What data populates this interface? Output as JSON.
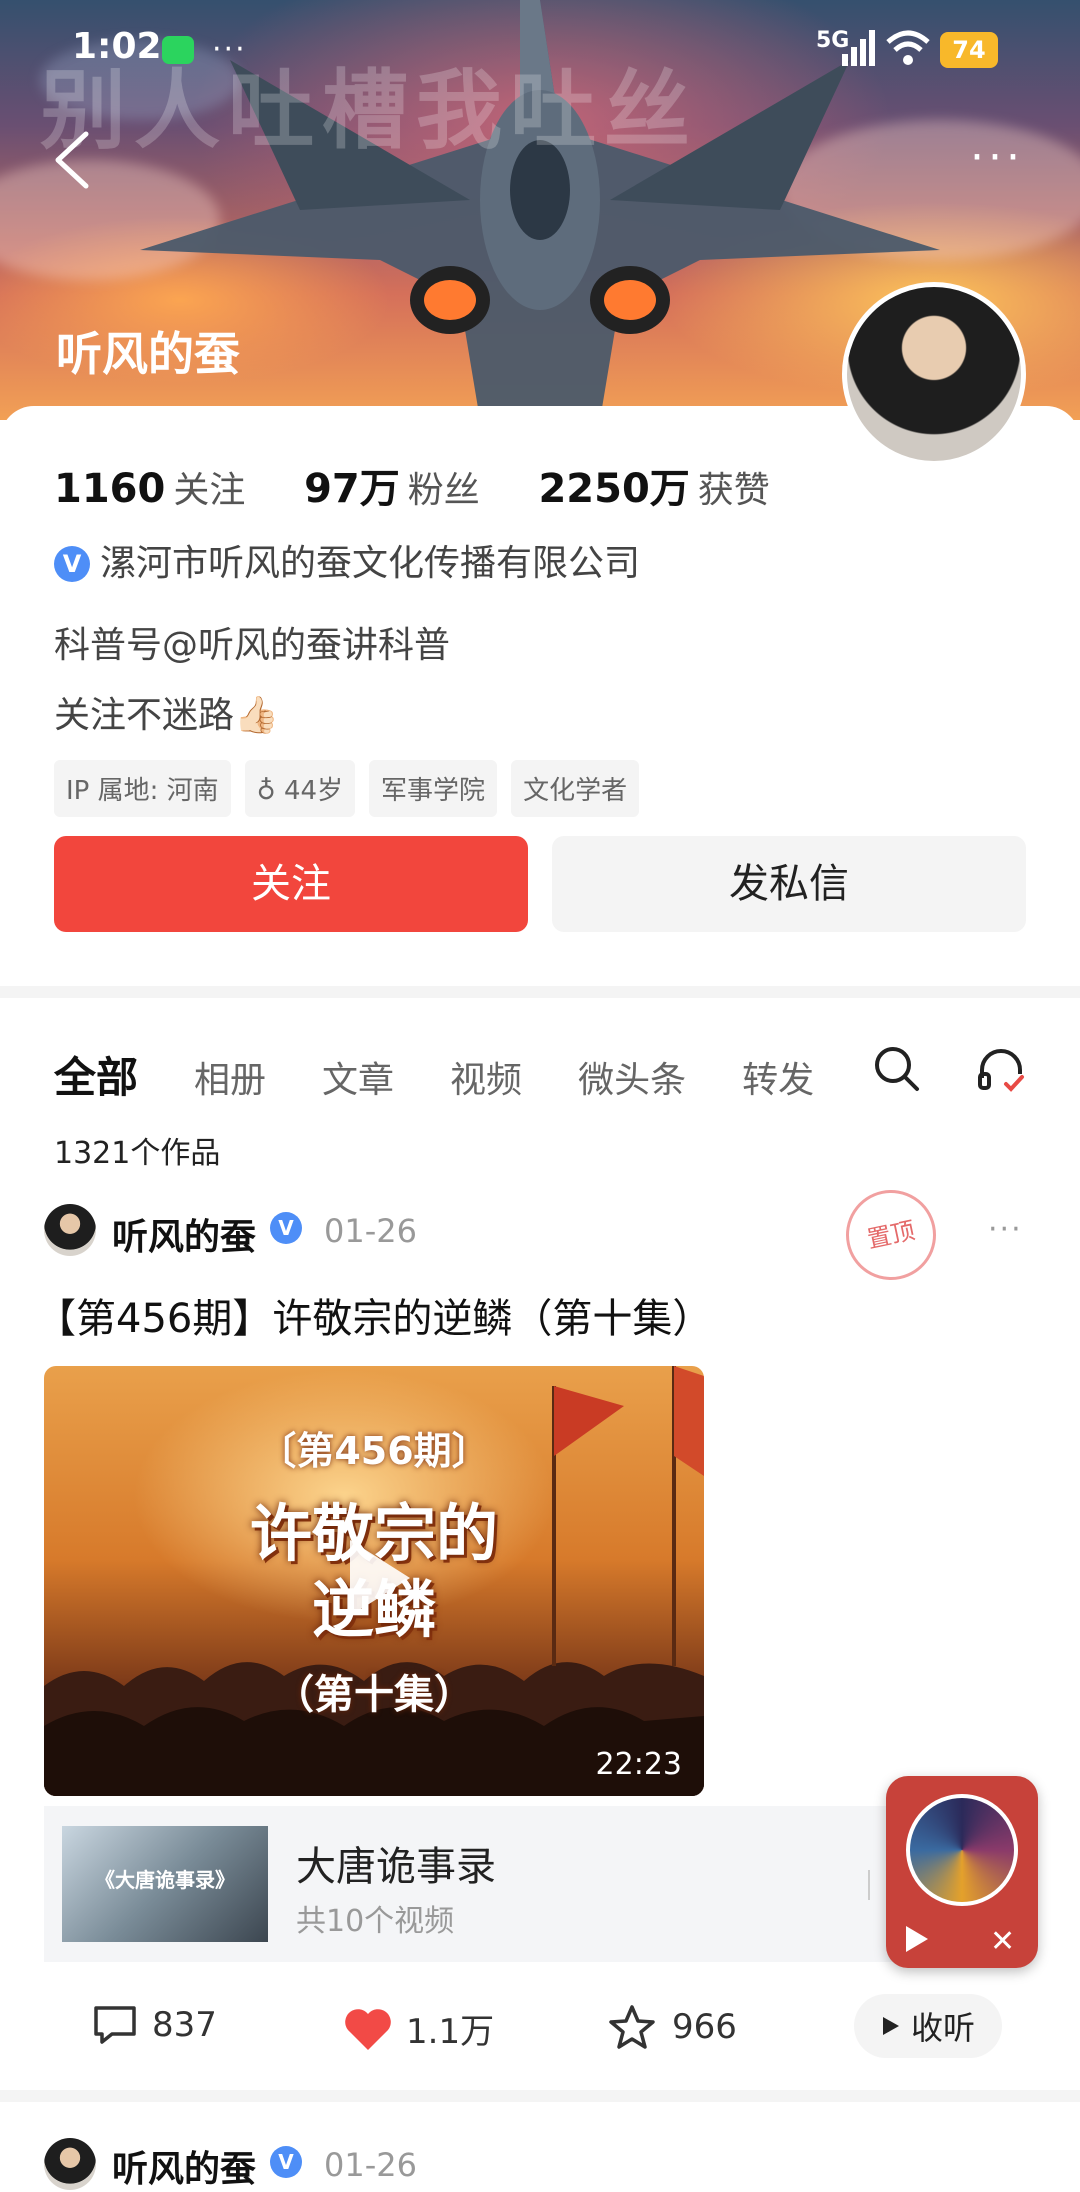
{
  "status_bar": {
    "time": "1:02",
    "network": "5G",
    "battery": "74"
  },
  "banner": {
    "title_text": "别人吐槽我吐丝",
    "nickname": "听风的蚕"
  },
  "stats": [
    {
      "value": "1160",
      "label": "关注"
    },
    {
      "value": "97万",
      "label": "粉丝"
    },
    {
      "value": "2250万",
      "label": "获赞"
    }
  ],
  "verification": {
    "badge": "V",
    "org": "漯河市听风的蚕文化传播有限公司"
  },
  "bio": {
    "line1": "科普号@听风的蚕讲科普",
    "line2": "关注不迷路👍🏻"
  },
  "tags": [
    "IP 属地: 河南",
    "♁ 44岁",
    "军事学院",
    "文化学者"
  ],
  "buttons": {
    "follow": "关注",
    "message": "发私信"
  },
  "tabs": [
    "全部",
    "相册",
    "文章",
    "视频",
    "微头条",
    "转发"
  ],
  "works_count": "1321个作品",
  "post": {
    "author": "听风的蚕",
    "verified": "V",
    "date": "01-26",
    "pinned_stamp": "置顶",
    "title": "【第456期】许敬宗的逆鳞（第十集）",
    "video": {
      "overlay_issue": "〔第456期〕",
      "overlay_title_1": "许敬宗的",
      "overlay_title_2": "逆鳞",
      "overlay_episode": "（第十集）",
      "duration": "22:23"
    },
    "series": {
      "thumb_label": "《大唐诡事录》",
      "title": "大唐诡事录",
      "subtitle": "共10个视频"
    },
    "actions": {
      "comments": "837",
      "likes": "1.1万",
      "favorites": "966",
      "listen": "收听"
    }
  },
  "next_post": {
    "author": "听风的蚕",
    "verified": "V",
    "date": "01-26"
  },
  "colors": {
    "accent_red": "#f2463d",
    "verify_blue": "#4e8ef7",
    "like_red": "#f24a46"
  }
}
